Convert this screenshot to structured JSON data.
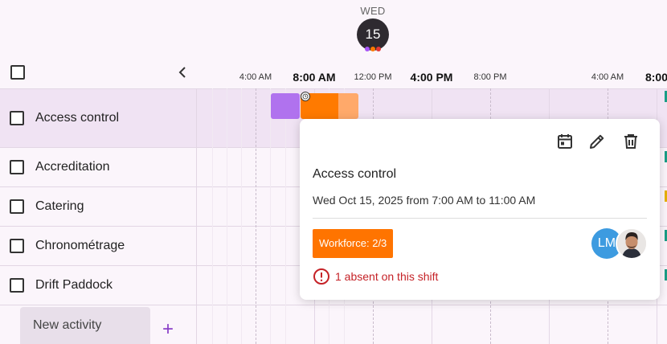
{
  "day_header": {
    "weekday": "WED",
    "day": "15"
  },
  "day_dots": [
    "#a855f7",
    "#ff7a00",
    "#e53935"
  ],
  "timeline": {
    "labels": [
      {
        "text": "4:00 AM",
        "size": "small"
      },
      {
        "text": "8:00 AM",
        "size": "big"
      },
      {
        "text": "12:00 PM",
        "size": "small"
      },
      {
        "text": "4:00 PM",
        "size": "big"
      },
      {
        "text": "8:00 PM",
        "size": "small"
      },
      {
        "text": "4:00 AM",
        "size": "small"
      },
      {
        "text": "8:00",
        "size": "big"
      }
    ]
  },
  "activities": [
    {
      "label": "Access control",
      "selected": true
    },
    {
      "label": "Accreditation"
    },
    {
      "label": "Catering"
    },
    {
      "label": "Chronométrage"
    },
    {
      "label": "Drift Paddock"
    }
  ],
  "new_activity": {
    "label": "New activity",
    "add_symbol": "+"
  },
  "colors": {
    "shift_purple": "#b072ee",
    "shift_orange": "#ff7a00",
    "workforce": "#ff7400",
    "absent": "#c52227",
    "edge_green": "#1a9e86",
    "edge_yellow": "#e6b100"
  },
  "popup": {
    "title": "Access control",
    "date": "Wed Oct 15, 2025 from 7:00 AM to 11:00 AM",
    "workforce": "Workforce: 2/3",
    "avatar_initials": "LM",
    "absent_text": "1 absent on this shift",
    "icons": [
      "calendar-icon",
      "pencil-icon",
      "trash-icon"
    ]
  }
}
